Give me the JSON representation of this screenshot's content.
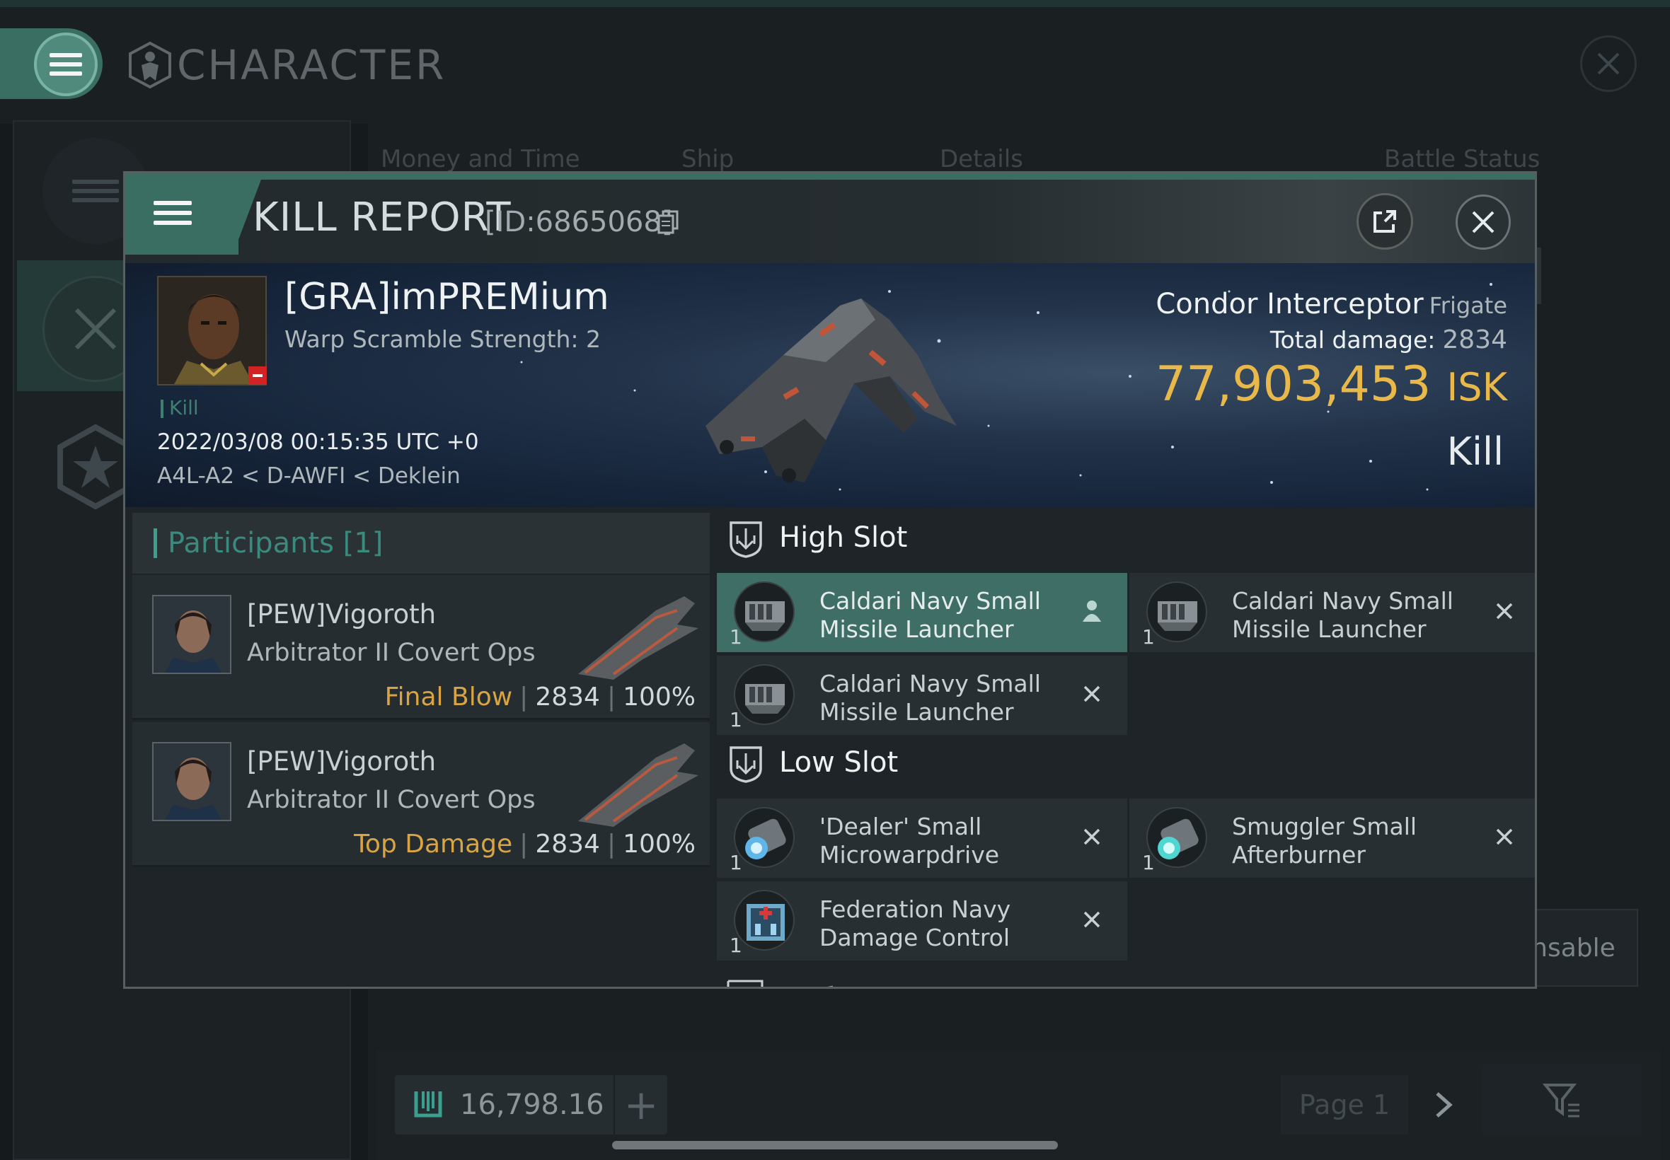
{
  "app": {
    "title": "CHARACTER",
    "bg_columns": [
      "Money and Time",
      "Ship",
      "Details",
      "Battle Status"
    ],
    "bg_dispensable_text": "ensable",
    "wallet_value": "16,798.16",
    "page_label": "Page 1"
  },
  "kill_report": {
    "title": "KILL REPORT",
    "id_label": "[ID:6865068]",
    "victim": {
      "name": "[GRA]imPREMium",
      "warp_scramble": "Warp Scramble Strength: 2",
      "kill_tag": "Kill",
      "timestamp": "2022/03/08 00:15:35 UTC +0",
      "location": "A4L-A2 < D-AWFI < Deklein"
    },
    "ship": {
      "name": "Condor Interceptor",
      "class": "Frigate",
      "total_damage_label": "Total damage:",
      "total_damage": "2834",
      "isk_value": "77,903,453",
      "isk_unit": "ISK",
      "result": "Kill"
    },
    "participants": {
      "title": "Participants [1]",
      "rows": [
        {
          "name": "[PEW]Vigoroth",
          "ship": "Arbitrator II Covert Ops",
          "tag": "Final Blow",
          "damage": "2834",
          "percent": "100%"
        },
        {
          "name": "[PEW]Vigoroth",
          "ship": "Arbitrator II Covert Ops",
          "tag": "Top Damage",
          "damage": "2834",
          "percent": "100%"
        }
      ]
    },
    "fitting": {
      "high_slot": {
        "label": "High Slot",
        "items": [
          {
            "name": "Caldari Navy Small Missile Launcher",
            "qty": "1",
            "action": "person-icon"
          },
          {
            "name": "Caldari Navy Small Missile Launcher",
            "qty": "1",
            "action": "close-icon"
          },
          {
            "name": "Caldari Navy Small Missile Launcher",
            "qty": "1",
            "action": "close-icon"
          }
        ]
      },
      "low_slot": {
        "label": "Low Slot",
        "items": [
          {
            "name": "'Dealer' Small Microwarpdrive",
            "qty": "1",
            "action": "close-icon"
          },
          {
            "name": "Smuggler Small Afterburner",
            "qty": "1",
            "action": "close-icon"
          },
          {
            "name": "Federation Navy Damage Control",
            "qty": "1",
            "action": "close-icon"
          }
        ]
      }
    }
  }
}
